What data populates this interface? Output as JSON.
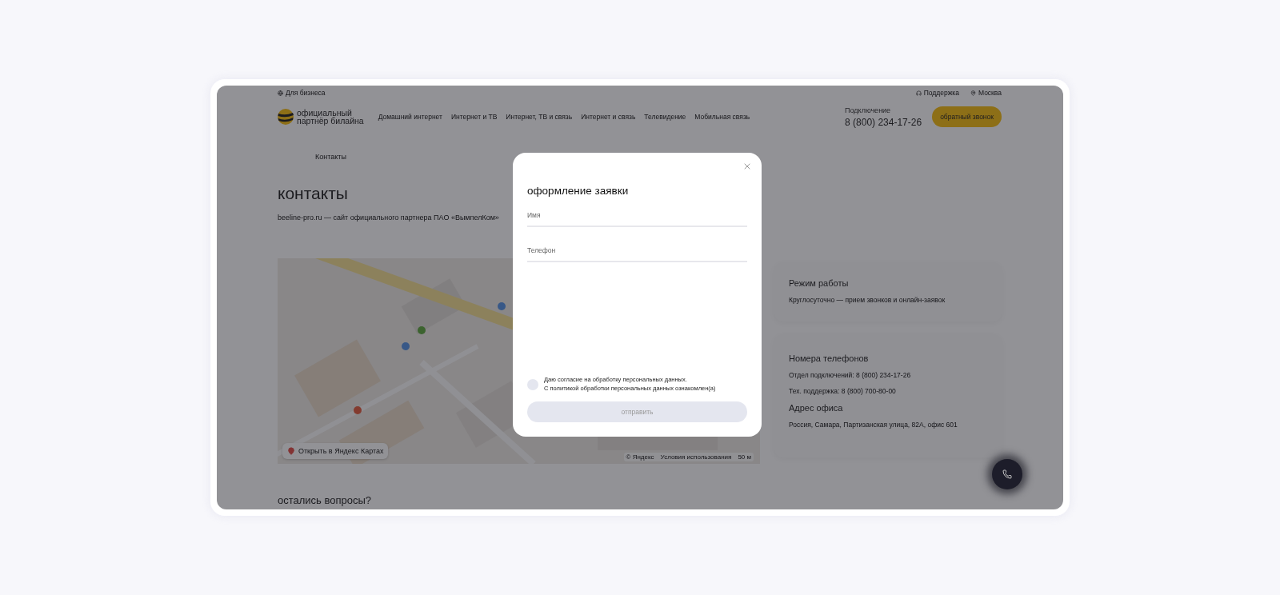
{
  "topbar": {
    "business": "Для бизнеса",
    "support": "Поддержка",
    "city": "Москва"
  },
  "header": {
    "logo": [
      "официальный",
      "партнёр билайна"
    ],
    "nav": [
      "Домашний интернет",
      "Интернет и ТВ",
      "Интернет, ТВ и связь",
      "Интернет и связь",
      "Телевидение",
      "Мобильная связь"
    ],
    "connection_label": "Подключение",
    "phone": "8 (800) 234-17-26",
    "callback_button": "обратный звонок"
  },
  "breadcrumbs": [
    "Контакты"
  ],
  "page": {
    "title": "контакты",
    "subtitle": "beeline-pro.ru — сайт официального партнера ПАО «ВымпелКом»"
  },
  "map": {
    "kind": "picture",
    "open_button": "Открыть в Яндекс Картах",
    "copyright": "© Яндекс",
    "terms": "Условия использования",
    "scale": "50 м"
  },
  "info_cards": [
    {
      "sections": [
        {
          "title": "Режим работы",
          "lines": [
            "Круглосуточно — прием звонков и онлайн-заявок"
          ]
        }
      ]
    },
    {
      "sections": [
        {
          "title": "Номера телефонов",
          "lines": [
            "Отдел подключений: 8 (800) 234-17-26",
            "Тех. поддержка: 8 (800) 700-80-00"
          ]
        },
        {
          "title": "Адрес офиса",
          "lines": [
            "Россия, Самара, Партизанская улица, 82А, офис 601"
          ]
        }
      ]
    }
  ],
  "footer_heading": "остались вопросы?",
  "modal": {
    "title": "оформление заявки",
    "fields": [
      {
        "placeholder": "Имя"
      },
      {
        "placeholder": "Телефон"
      }
    ],
    "consent": {
      "checked": false,
      "lines": [
        "Даю согласие на обработку персональных данных.",
        "С политикой обработки персональных данных ознакомлен(а)"
      ]
    },
    "submit": {
      "label": "отправить",
      "disabled": true
    }
  }
}
